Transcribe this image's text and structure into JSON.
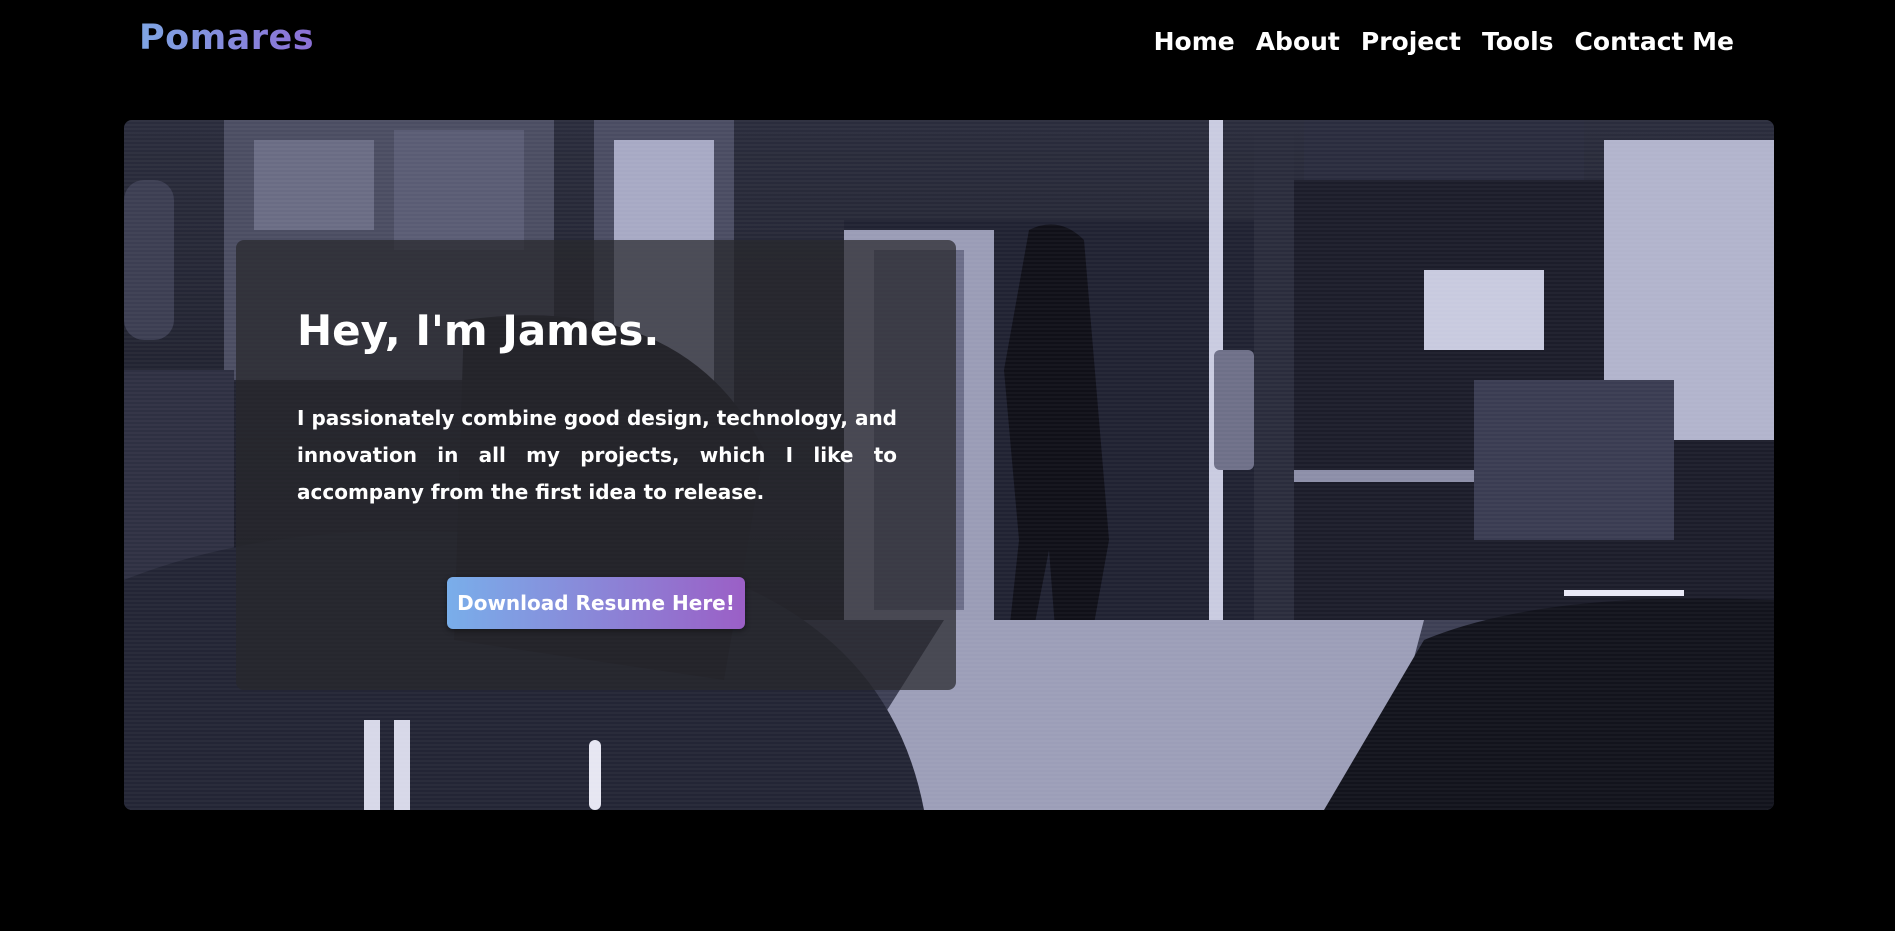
{
  "header": {
    "logo": "Pomares",
    "nav": [
      {
        "label": "Home"
      },
      {
        "label": "About"
      },
      {
        "label": "Project"
      },
      {
        "label": "Tools"
      },
      {
        "label": "Contact Me"
      }
    ]
  },
  "hero": {
    "title": "Hey, I'm James.",
    "description": "I passionately combine good design, technology, and innovation in all my projects, which I like to accompany from the first idea to release.",
    "cta_label": "Download Resume Here!"
  },
  "colors": {
    "background": "#000000",
    "logo_gradient": [
      "#7fa6e4",
      "#8b6fd6"
    ],
    "button_gradient": [
      "#79aeea",
      "#9b5fc6"
    ]
  }
}
